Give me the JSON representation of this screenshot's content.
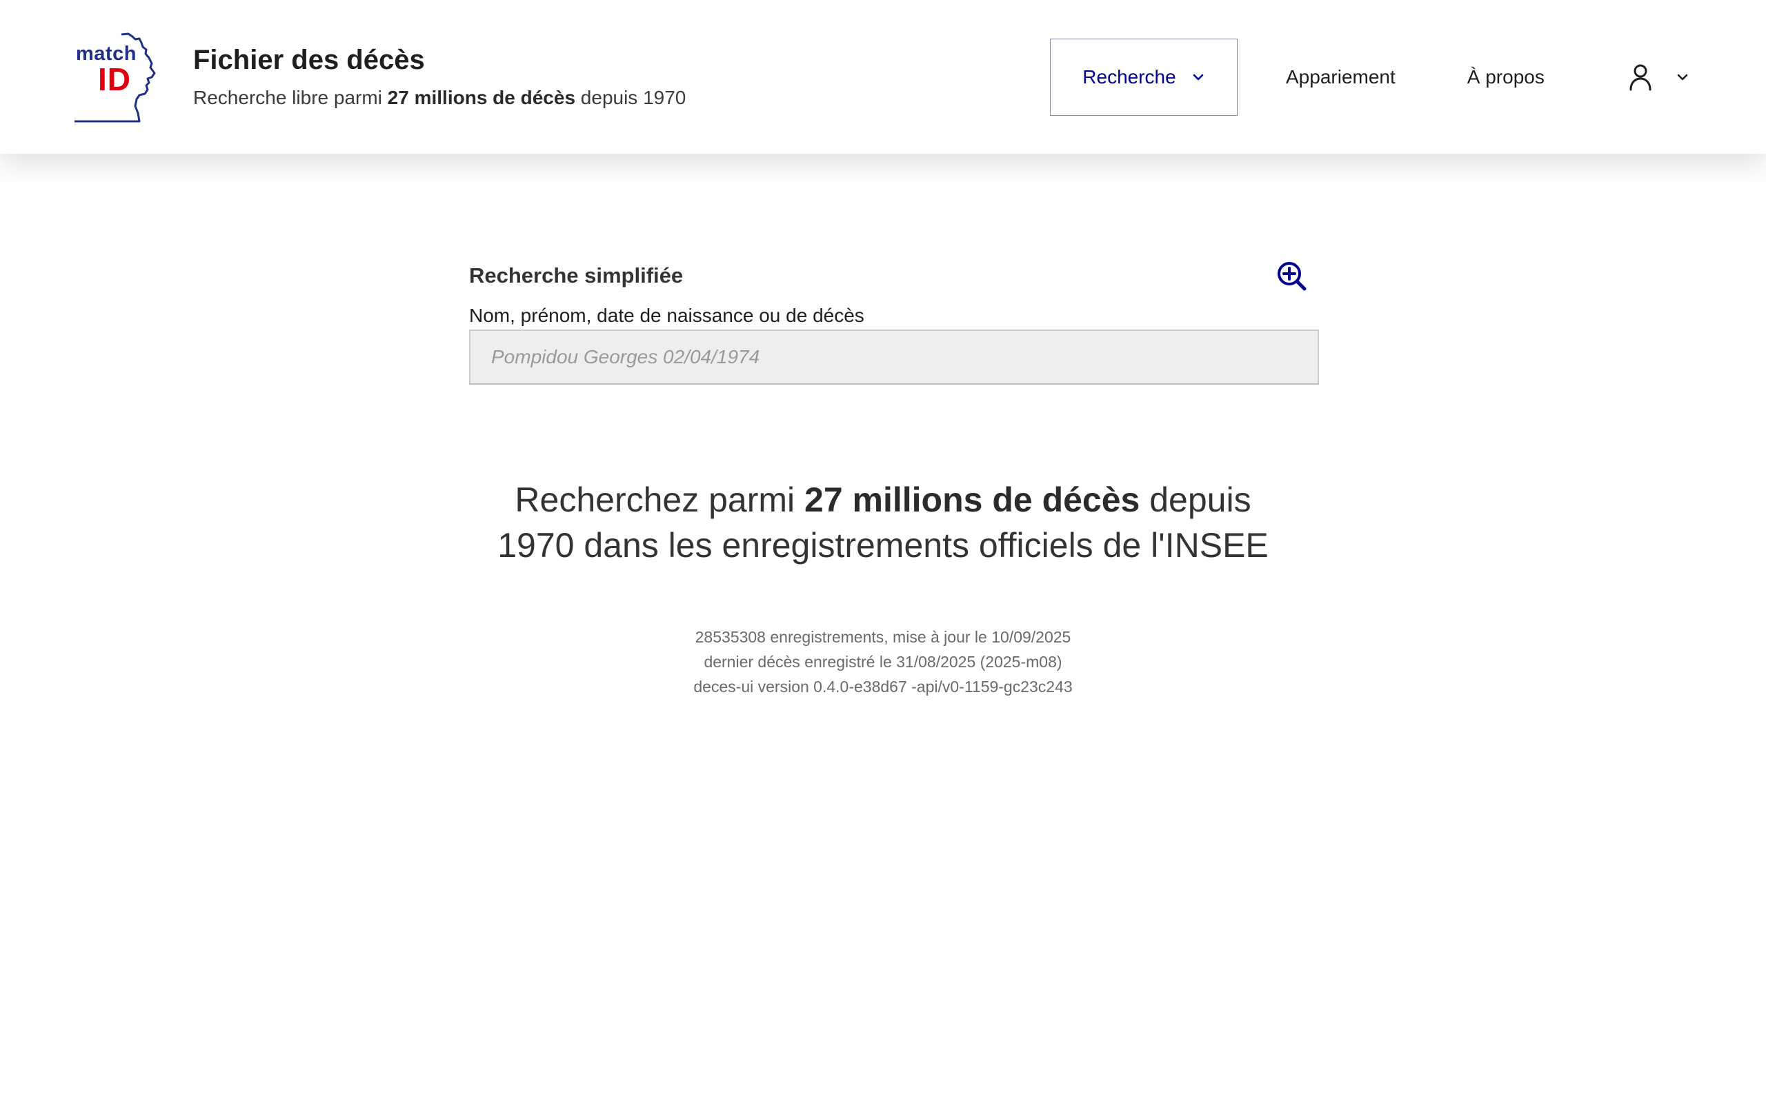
{
  "header": {
    "logo": {
      "line1": "match",
      "line2": "ID"
    },
    "title": "Fichier des décès",
    "tagline": {
      "prefix": "Recherche libre parmi ",
      "bold": "27 millions de décès",
      "suffix": " depuis 1970"
    }
  },
  "nav": {
    "search": "Recherche",
    "matching": "Appariement",
    "about": "À propos",
    "user_icon": "user-icon",
    "chevron_icon": "chevron-down-icon"
  },
  "search": {
    "title": "Recherche simplifiée",
    "label": "Nom, prénom, date de naissance ou de décès",
    "placeholder": "Pompidou Georges 02/04/1974",
    "value": "",
    "advanced_icon": "zoom-in-icon"
  },
  "hero": {
    "prefix": "Recherchez parmi ",
    "bold": "27 millions de décès",
    "suffix": " depuis",
    "line2": "1970 dans les enregistrements officiels de l'INSEE"
  },
  "meta": {
    "records": "28535308 enregistrements, mise à jour le 10/09/2025",
    "last_death": "dernier décès enregistré le 31/08/2025 (2025-m08)",
    "version": "deces-ui version 0.4.0-e38d67 -api/v0-1159-gc23c243"
  },
  "colors": {
    "primary_blue": "#000091",
    "logo_blue": "#1f2f86",
    "logo_red": "#e1000f",
    "input_background": "#eeeeee",
    "meta_text": "#6a6a6a"
  }
}
